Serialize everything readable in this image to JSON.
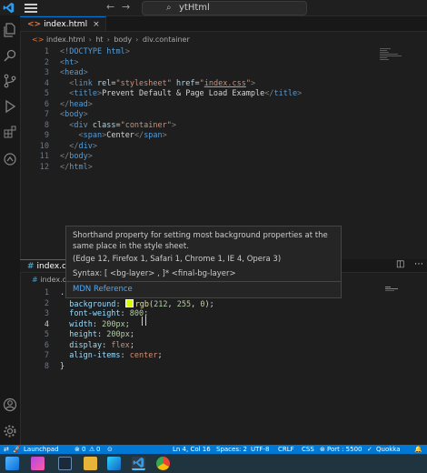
{
  "titlebar": {
    "search_text": "ytHtml"
  },
  "editor_top": {
    "tab_label": "index.html",
    "breadcrumb": [
      "index.html",
      "ht",
      "body",
      "div.container"
    ],
    "lines": [
      {
        "n": "1",
        "tokens": [
          [
            "tg",
            "<"
          ],
          [
            "tn",
            "!DOCTYPE"
          ],
          [
            "tx",
            " "
          ],
          [
            "tn",
            "html"
          ],
          [
            "tg",
            ">"
          ]
        ]
      },
      {
        "n": "2",
        "tokens": [
          [
            "tg",
            "<"
          ],
          [
            "tn",
            "ht"
          ],
          [
            "tg",
            ">"
          ]
        ]
      },
      {
        "n": "3",
        "tokens": [
          [
            "tg",
            "<"
          ],
          [
            "tn",
            "head"
          ],
          [
            "tg",
            ">"
          ]
        ]
      },
      {
        "n": "4",
        "tokens": [
          [
            "tx",
            "  "
          ],
          [
            "tg",
            "<"
          ],
          [
            "tn",
            "link"
          ],
          [
            "tx",
            " "
          ],
          [
            "at",
            "rel"
          ],
          [
            "tx",
            "="
          ],
          [
            "sv",
            "\"stylesheet\""
          ],
          [
            "tx",
            " "
          ],
          [
            "at",
            "href"
          ],
          [
            "tx",
            "="
          ],
          [
            "sv",
            "\""
          ],
          [
            "sv link",
            "index.css"
          ],
          [
            "sv",
            "\""
          ],
          [
            "tg",
            ">"
          ]
        ]
      },
      {
        "n": "5",
        "tokens": [
          [
            "tx",
            "  "
          ],
          [
            "tg",
            "<"
          ],
          [
            "tn",
            "title"
          ],
          [
            "tg",
            ">"
          ],
          [
            "tx",
            "Prevent Default & Page Load Example"
          ],
          [
            "tg",
            "</"
          ],
          [
            "tn",
            "title"
          ],
          [
            "tg",
            ">"
          ]
        ]
      },
      {
        "n": "6",
        "tokens": [
          [
            "tg",
            "</"
          ],
          [
            "tn",
            "head"
          ],
          [
            "tg",
            ">"
          ]
        ]
      },
      {
        "n": "7",
        "tokens": [
          [
            "tg",
            "<"
          ],
          [
            "tn",
            "body"
          ],
          [
            "tg",
            ">"
          ]
        ]
      },
      {
        "n": "8",
        "tokens": [
          [
            "tx",
            "  "
          ],
          [
            "tg",
            "<"
          ],
          [
            "tn",
            "div"
          ],
          [
            "tx",
            " "
          ],
          [
            "at",
            "class"
          ],
          [
            "tx",
            "="
          ],
          [
            "sv",
            "\"container\""
          ],
          [
            "tg",
            ">"
          ]
        ]
      },
      {
        "n": "9",
        "tokens": [
          [
            "tx",
            "    "
          ],
          [
            "tg",
            "<"
          ],
          [
            "tn",
            "span"
          ],
          [
            "tg",
            ">"
          ],
          [
            "tx",
            "Center"
          ],
          [
            "tg",
            "</"
          ],
          [
            "tn",
            "span"
          ],
          [
            "tg",
            ">"
          ]
        ]
      },
      {
        "n": "10",
        "tokens": [
          [
            "tx",
            "  "
          ],
          [
            "tg",
            "</"
          ],
          [
            "tn",
            "div"
          ],
          [
            "tg",
            ">"
          ]
        ]
      },
      {
        "n": "11",
        "tokens": [
          [
            "tg",
            "</"
          ],
          [
            "tn",
            "body"
          ],
          [
            "tg",
            ">"
          ]
        ]
      },
      {
        "n": "12",
        "tokens": [
          [
            "tg",
            "</"
          ],
          [
            "tn",
            "html"
          ],
          [
            "tg",
            ">"
          ]
        ]
      }
    ]
  },
  "hover": {
    "description": "Shorthand property for setting most background properties at the same place in the style sheet.",
    "browsers": "(Edge 12, Firefox 1, Safari 1, Chrome 1, IE 4, Opera 3)",
    "syntax": "Syntax: [ <bg-layer> , ]* <final-bg-layer>",
    "reference": "MDN Reference"
  },
  "editor_bottom": {
    "tab_label": "index.css",
    "breadcrumb_partial": "index.cs",
    "lines": [
      {
        "n": "1",
        "tokens": [
          [
            "tx",
            ".c"
          ]
        ]
      },
      {
        "n": "2",
        "tokens": [
          [
            "tx",
            "  "
          ],
          [
            "pr",
            "background"
          ],
          [
            "tx",
            ": "
          ],
          [
            "swatch",
            "#d4ff00"
          ],
          [
            "fn",
            "rgb"
          ],
          [
            "tx",
            "("
          ],
          [
            "nm",
            "212"
          ],
          [
            "tx",
            ", "
          ],
          [
            "nm",
            "255"
          ],
          [
            "tx",
            ", "
          ],
          [
            "nm",
            "0"
          ],
          [
            "tx",
            ");"
          ]
        ]
      },
      {
        "n": "3",
        "tokens": [
          [
            "tx",
            "  "
          ],
          [
            "pr",
            "font-weight"
          ],
          [
            "tx",
            ": "
          ],
          [
            "nm",
            "800"
          ],
          [
            "tx",
            ";"
          ]
        ]
      },
      {
        "n": "4",
        "tokens": [
          [
            "tx",
            "  "
          ],
          [
            "pr",
            "width"
          ],
          [
            "tx",
            ": "
          ],
          [
            "nm",
            "200px"
          ],
          [
            "tx",
            ";"
          ]
        ]
      },
      {
        "n": "5",
        "tokens": [
          [
            "tx",
            "  "
          ],
          [
            "pr",
            "height"
          ],
          [
            "tx",
            ": "
          ],
          [
            "nm",
            "200px"
          ],
          [
            "tx",
            ";"
          ]
        ]
      },
      {
        "n": "6",
        "tokens": [
          [
            "tx",
            "  "
          ],
          [
            "pr",
            "display"
          ],
          [
            "tx",
            ": "
          ],
          [
            "kw",
            "flex"
          ],
          [
            "tx",
            ";"
          ]
        ]
      },
      {
        "n": "7",
        "tokens": [
          [
            "tx",
            "  "
          ],
          [
            "pr",
            "align-items"
          ],
          [
            "tx",
            ": "
          ],
          [
            "kw",
            "center"
          ],
          [
            "tx",
            ";"
          ]
        ]
      },
      {
        "n": "8",
        "tokens": [
          [
            "tx",
            "}"
          ]
        ]
      }
    ],
    "current_line": "4"
  },
  "statusbar": {
    "launchpad": "Launchpad",
    "errors": "0",
    "warnings": "0",
    "cursor_pos": "Ln 4, Col 16",
    "spaces": "Spaces: 2",
    "encoding": "UTF-8",
    "eol": "CRLF",
    "language": "CSS",
    "port": "Port : 5500",
    "quokka": "Quokka"
  },
  "colors": {
    "accent": "#0078d4",
    "status_bar": "#0078d4",
    "taskbar": "#20343f"
  }
}
